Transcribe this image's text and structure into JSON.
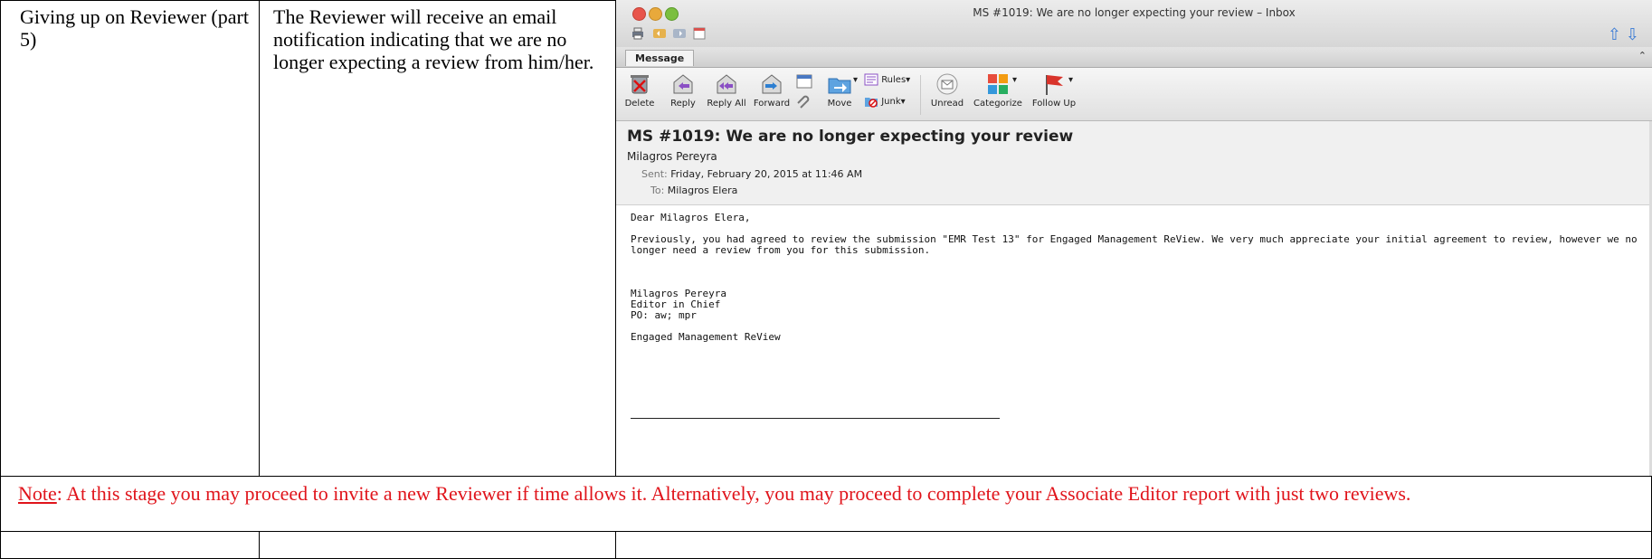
{
  "table": {
    "row1": {
      "step": "Giving up on Reviewer (part 5)",
      "description": "The Reviewer will receive an email notification indicating that we are no longer expecting a review from him/her."
    },
    "note": {
      "label": "Note",
      "text": ": At this stage you may proceed to invite a new Reviewer if time allows it.  Alternatively, you may proceed to complete your Associate Editor report with just two reviews."
    }
  },
  "mail": {
    "window_title": "MS #1019: We are no longer expecting your review – Inbox",
    "tab": "Message",
    "toolbar": {
      "delete": "Delete",
      "reply": "Reply",
      "reply_all": "Reply All",
      "forward": "Forward",
      "move": "Move",
      "rules": "Rules",
      "junk": "Junk",
      "unread": "Unread",
      "categorize": "Categorize",
      "follow_up": "Follow Up"
    },
    "subject": "MS #1019: We are no longer expecting your review",
    "sender": "Milagros Pereyra",
    "sent_label": "Sent:",
    "sent_value": "Friday, February 20, 2015 at 11:46 AM",
    "to_label": "To:",
    "to_value": "Milagros Elera",
    "body": {
      "greeting": "Dear Milagros Elera,",
      "para1_line1": "Previously, you had agreed to review the submission \"EMR Test 13\" for Engaged Management ReView. We very much appreciate your initial agreement to review, however we no",
      "para1_line2": "longer need a review from you for this submission.",
      "sig_name": "Milagros Pereyra",
      "sig_title": "Editor in Chief",
      "sig_po": "PO: aw; mpr",
      "sig_journal": "Engaged Management ReView"
    }
  },
  "colors": {
    "note_red": "#e0141b",
    "link_blue": "#3a7bd5"
  }
}
